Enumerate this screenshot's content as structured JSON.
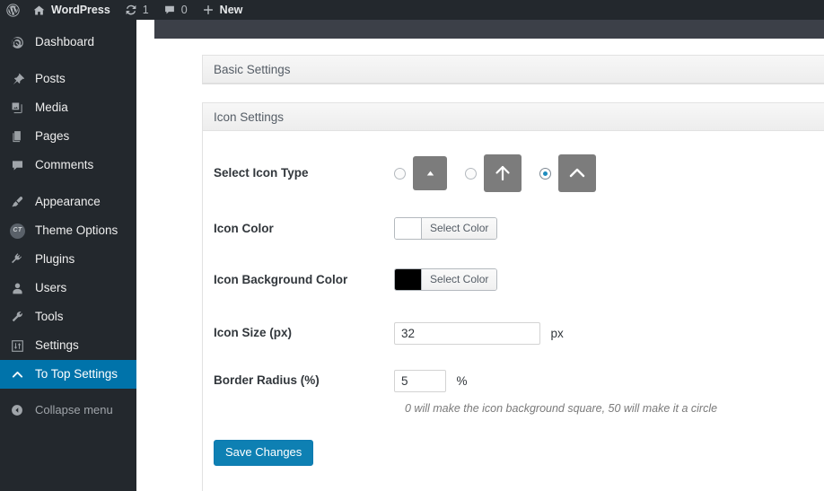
{
  "adminbar": {
    "logo_icon": "wordpress-logo-icon",
    "site_name": "WordPress",
    "site_icon": "home-icon",
    "updates_icon": "updates-icon",
    "updates_count": "1",
    "comments_icon": "comment-bubble-icon",
    "comments_count": "0",
    "new_icon": "plus-icon",
    "new_label": "New"
  },
  "sidebar": {
    "items": [
      {
        "label": "Dashboard",
        "icon": "dashboard-icon",
        "active": false
      },
      {
        "label": "Posts",
        "icon": "pin-icon",
        "active": false
      },
      {
        "label": "Media",
        "icon": "media-icon",
        "active": false
      },
      {
        "label": "Pages",
        "icon": "pages-icon",
        "active": false
      },
      {
        "label": "Comments",
        "icon": "comment-bubble-icon",
        "active": false
      },
      {
        "label": "Appearance",
        "icon": "paintbrush-icon",
        "active": false
      },
      {
        "label": "Theme Options",
        "icon": "ct-badge-icon",
        "active": false
      },
      {
        "label": "Plugins",
        "icon": "plug-icon",
        "active": false
      },
      {
        "label": "Users",
        "icon": "user-icon",
        "active": false
      },
      {
        "label": "Tools",
        "icon": "wrench-icon",
        "active": false
      },
      {
        "label": "Settings",
        "icon": "sliders-icon",
        "active": false
      },
      {
        "label": "To Top Settings",
        "icon": "chevron-up-icon",
        "active": true
      }
    ],
    "collapse": {
      "label": "Collapse menu",
      "icon": "collapse-arrow-icon"
    }
  },
  "panels": {
    "basic": {
      "title": "Basic Settings"
    },
    "icon": {
      "title": "Icon Settings"
    }
  },
  "form": {
    "icon_type": {
      "label": "Select Icon Type",
      "options": [
        {
          "icon": "triangle-up-icon",
          "checked": false,
          "size": "sm"
        },
        {
          "icon": "arrow-up-icon",
          "checked": false,
          "size": "md"
        },
        {
          "icon": "chevron-up-icon",
          "checked": true,
          "size": "md"
        }
      ]
    },
    "icon_color": {
      "label": "Icon Color",
      "button_label": "Select Color",
      "value": "#ffffff"
    },
    "icon_bg_color": {
      "label": "Icon Background Color",
      "button_label": "Select Color",
      "value": "#000000"
    },
    "icon_size": {
      "label": "Icon Size (px)",
      "value": "32",
      "unit": "px"
    },
    "border_radius": {
      "label": "Border Radius (%)",
      "value": "5",
      "unit": "%",
      "help": "0 will make the icon background square, 50 will make it a circle"
    },
    "save_label": "Save Changes"
  },
  "colors": {
    "accent": "#0073aa",
    "button": "#0e80b3",
    "adminbar_bg": "#23282d",
    "sidebar_bg": "#23282d",
    "radio_dot": "#1e8cbe",
    "icon_box_bg": "#7c7c7c"
  }
}
